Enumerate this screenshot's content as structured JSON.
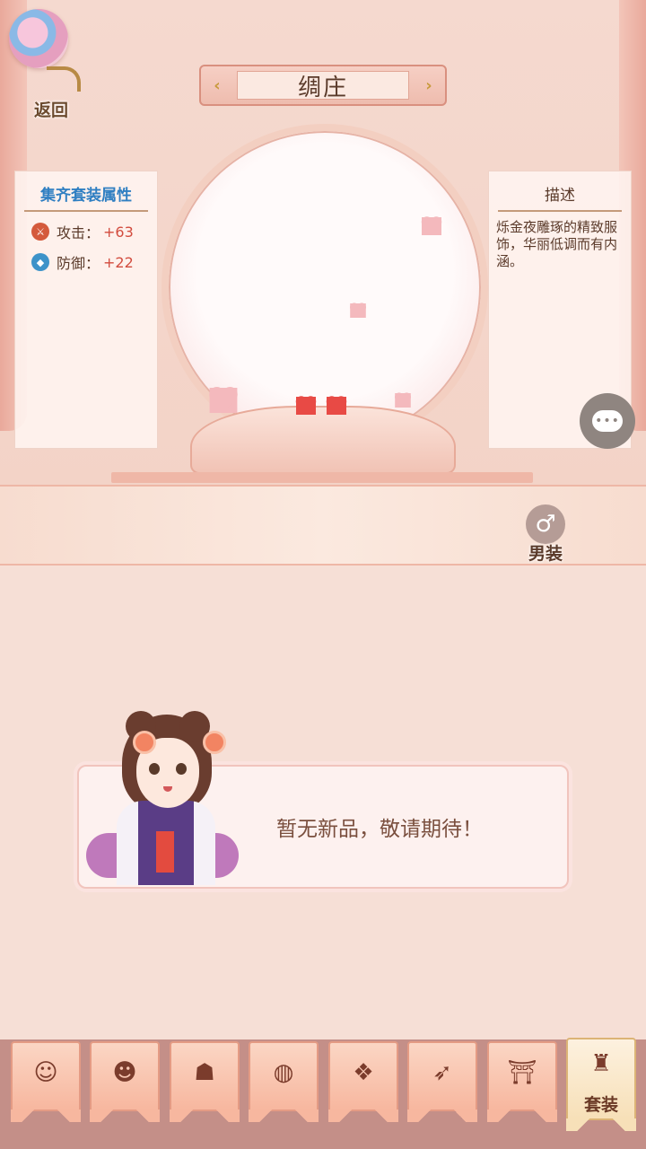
{
  "header": {
    "back_label": "返回",
    "title": "绸庄"
  },
  "set_panel": {
    "title": "集齐套装属性",
    "stats": [
      {
        "label": "攻击：",
        "value": "+63",
        "icon": "attack-icon"
      },
      {
        "label": "防御：",
        "value": "+22",
        "icon": "defense-icon"
      }
    ]
  },
  "desc_panel": {
    "title": "描述",
    "text": "烁金夜雕琢的精致服饰，华丽低调而有内涵。"
  },
  "gender_toggle": {
    "label": "男装",
    "icon": "male-symbol-icon"
  },
  "dialog": {
    "text": "暂无新品，敬请期待！"
  },
  "tabs": [
    {
      "icon": "hairstyle-icon",
      "label": ""
    },
    {
      "icon": "face-icon",
      "label": ""
    },
    {
      "icon": "clothing-icon",
      "label": ""
    },
    {
      "icon": "lantern-icon",
      "label": ""
    },
    {
      "icon": "earring-icon",
      "label": ""
    },
    {
      "icon": "feather-icon",
      "label": ""
    },
    {
      "icon": "temple-icon",
      "label": ""
    },
    {
      "icon": "costume-set-icon",
      "label": "套装",
      "active": true
    }
  ],
  "colors": {
    "accent_blue": "#2f7fc2",
    "stat_value_red": "#d24c3e",
    "tab_active_bg": "#f7e0b8",
    "tab_bg": "#f7b79f"
  }
}
